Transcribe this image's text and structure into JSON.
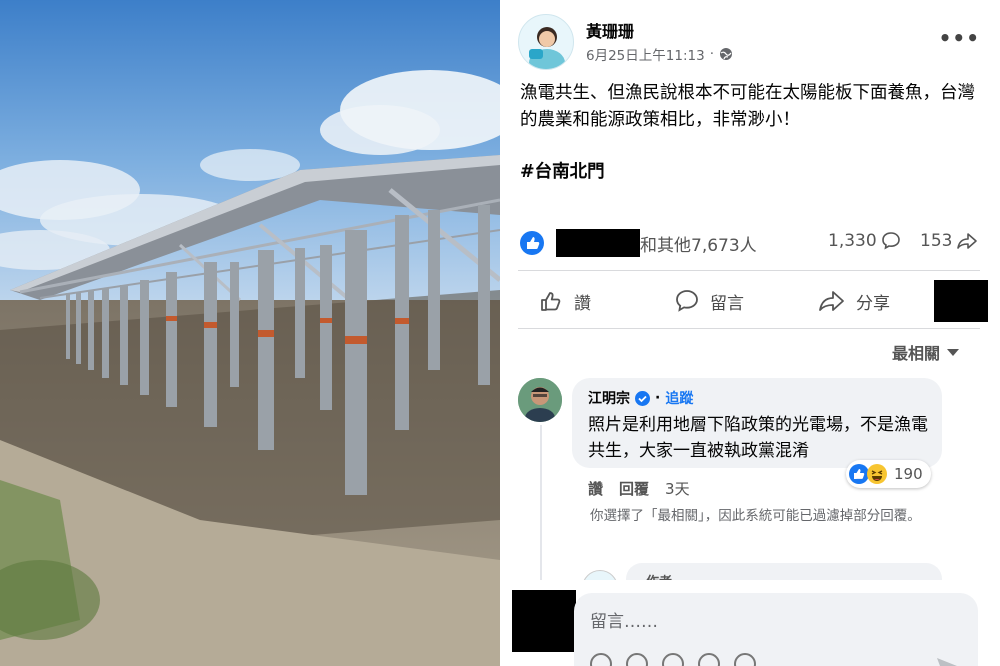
{
  "photo": {
    "description_icon": "solar-panel-field-photo"
  },
  "post": {
    "author": "黃珊珊",
    "timestamp": "6月25日上午11:13",
    "dot": "·",
    "privacy_icon": "globe-icon",
    "more_icon": "•••",
    "text": "漁電共生、但漁民說根本不可能在太陽能板下面養魚，台灣的農業和能源政策相比，非常渺小！",
    "hashtag": "#台南北門"
  },
  "reactions": {
    "reactors_text": "和其他7,673人",
    "comment_count": "1,330",
    "share_count": "153"
  },
  "actions": {
    "like_label": "讚",
    "comment_label": "留言",
    "share_label": "分享"
  },
  "comments": {
    "sort_label": "最相關",
    "items": [
      {
        "author": "江明宗",
        "follow_label": "追蹤",
        "text": "照片是利用地層下陷政策的光電場，不是漁電共生，大家一直被執政黨混淆",
        "reaction_count": "190",
        "like_label": "讚",
        "reply_label": "回覆",
        "time": "3天"
      }
    ],
    "filter_notice": "你選擇了「最相關」，因此系統可能已過濾掉部分回覆。",
    "reply_preview_label": "作者"
  },
  "compose": {
    "placeholder": "留言……"
  },
  "colors": {
    "facebook_blue": "#1877f2",
    "muted_text": "#65676b",
    "bubble_bg": "#f0f2f5"
  }
}
